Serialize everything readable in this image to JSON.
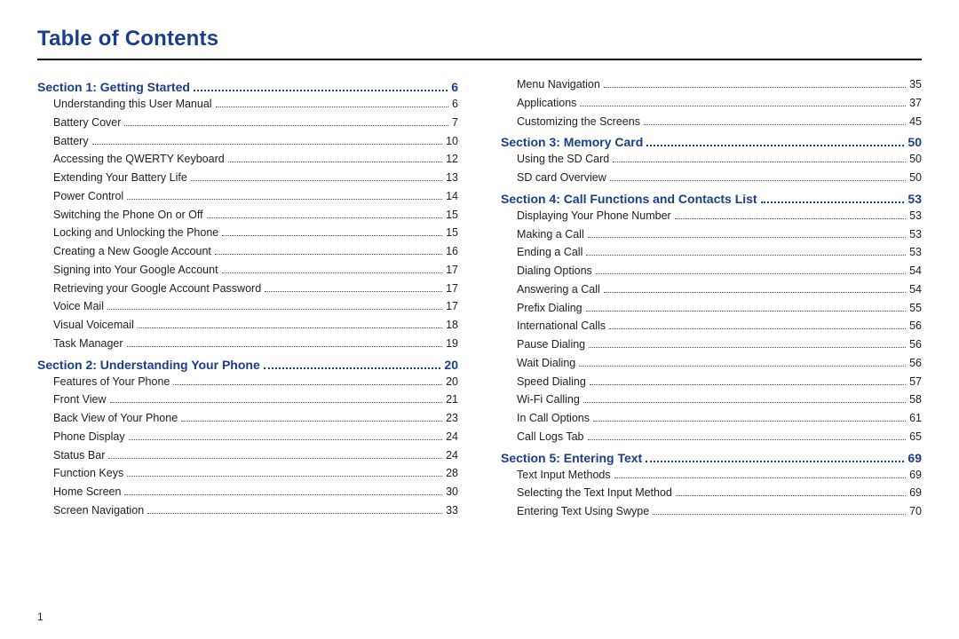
{
  "title": "Table of Contents",
  "page_number": "1",
  "columns": [
    [
      {
        "type": "section",
        "label": "Section 1:  Getting Started",
        "page": "6"
      },
      {
        "type": "item",
        "label": "Understanding this User Manual",
        "page": "6"
      },
      {
        "type": "item",
        "label": "Battery Cover",
        "page": "7"
      },
      {
        "type": "item",
        "label": "Battery",
        "page": "10"
      },
      {
        "type": "item",
        "label": "Accessing the QWERTY Keyboard",
        "page": "12"
      },
      {
        "type": "item",
        "label": "Extending Your Battery Life",
        "page": "13"
      },
      {
        "type": "item",
        "label": "Power Control",
        "page": "14"
      },
      {
        "type": "item",
        "label": "Switching the Phone On or Off",
        "page": "15"
      },
      {
        "type": "item",
        "label": "Locking and Unlocking the Phone",
        "page": "15"
      },
      {
        "type": "item",
        "label": "Creating a New Google Account",
        "page": "16"
      },
      {
        "type": "item",
        "label": "Signing into Your Google Account",
        "page": "17"
      },
      {
        "type": "item",
        "label": "Retrieving your Google Account Password",
        "page": "17"
      },
      {
        "type": "item",
        "label": "Voice Mail",
        "page": "17"
      },
      {
        "type": "item",
        "label": "Visual Voicemail",
        "page": "18"
      },
      {
        "type": "item",
        "label": "Task Manager",
        "page": "19"
      },
      {
        "type": "section",
        "label": "Section 2:  Understanding Your Phone",
        "page": "20"
      },
      {
        "type": "item",
        "label": "Features of Your Phone",
        "page": "20"
      },
      {
        "type": "item",
        "label": "Front View",
        "page": "21"
      },
      {
        "type": "item",
        "label": "Back View of Your Phone",
        "page": "23"
      },
      {
        "type": "item",
        "label": "Phone Display",
        "page": "24"
      },
      {
        "type": "item",
        "label": "Status Bar",
        "page": "24"
      },
      {
        "type": "item",
        "label": "Function Keys",
        "page": "28"
      },
      {
        "type": "item",
        "label": "Home Screen",
        "page": "30"
      },
      {
        "type": "item",
        "label": "Screen Navigation",
        "page": "33"
      }
    ],
    [
      {
        "type": "item",
        "label": "Menu Navigation",
        "page": "35"
      },
      {
        "type": "item",
        "label": "Applications",
        "page": "37"
      },
      {
        "type": "item",
        "label": "Customizing the Screens",
        "page": "45"
      },
      {
        "type": "section",
        "label": "Section 3:  Memory Card",
        "page": "50"
      },
      {
        "type": "item",
        "label": "Using the SD Card",
        "page": "50"
      },
      {
        "type": "item",
        "label": "SD card Overview",
        "page": "50"
      },
      {
        "type": "section",
        "label": "Section 4:  Call Functions and Contacts List",
        "page": "53"
      },
      {
        "type": "item",
        "label": "Displaying Your Phone Number",
        "page": "53"
      },
      {
        "type": "item",
        "label": "Making a Call",
        "page": "53"
      },
      {
        "type": "item",
        "label": "Ending a Call",
        "page": "53"
      },
      {
        "type": "item",
        "label": "Dialing Options",
        "page": "54"
      },
      {
        "type": "item",
        "label": "Answering a Call",
        "page": "54"
      },
      {
        "type": "item",
        "label": "Prefix Dialing",
        "page": "55"
      },
      {
        "type": "item",
        "label": "International Calls",
        "page": "56"
      },
      {
        "type": "item",
        "label": "Pause Dialing",
        "page": "56"
      },
      {
        "type": "item",
        "label": "Wait Dialing",
        "page": "56"
      },
      {
        "type": "item",
        "label": "Speed Dialing",
        "page": "57"
      },
      {
        "type": "item",
        "label": "Wi-Fi Calling",
        "page": "58"
      },
      {
        "type": "item",
        "label": "In Call Options",
        "page": "61"
      },
      {
        "type": "item",
        "label": "Call Logs Tab",
        "page": "65"
      },
      {
        "type": "section",
        "label": "Section 5:  Entering Text",
        "page": "69"
      },
      {
        "type": "item",
        "label": "Text Input Methods",
        "page": "69"
      },
      {
        "type": "item",
        "label": "Selecting the Text Input Method",
        "page": "69"
      },
      {
        "type": "item",
        "label": "Entering Text Using Swype",
        "page": "70"
      }
    ]
  ]
}
